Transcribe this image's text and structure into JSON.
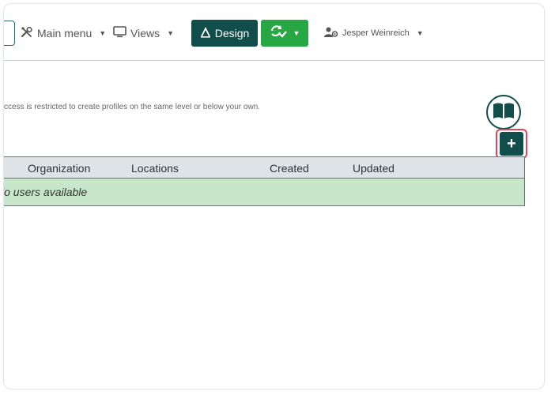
{
  "navbar": {
    "main_menu_label": "Main menu",
    "views_label": "Views",
    "design_label": "Design",
    "user_name": "Jesper Weinreich",
    "colors": {
      "primary": "#114d4b",
      "success": "#28a745"
    }
  },
  "content": {
    "info_text": "ccess is restricted to create profiles on the same level or below your own.",
    "add_button_label": "+"
  },
  "table": {
    "columns": [
      "Organization",
      "Locations",
      "Created",
      "Updated"
    ],
    "empty_text": "lo users available",
    "empty_row_color": "#c8e6c9"
  },
  "icons": [
    "tools-icon",
    "monitor-icon",
    "design-icon",
    "sync-check-icon",
    "user-gear-icon",
    "book-icon",
    "plus-icon"
  ]
}
